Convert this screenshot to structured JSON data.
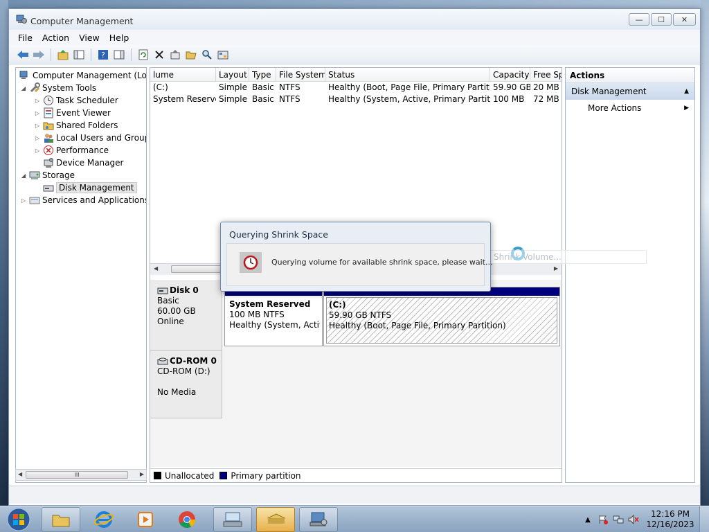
{
  "window": {
    "title": "Computer Management",
    "controls": {
      "minimize": "—",
      "maximize": "☐",
      "close": "✕"
    }
  },
  "menu": [
    "File",
    "Action",
    "View",
    "Help"
  ],
  "tree": {
    "root": "Computer Management (Local",
    "items": [
      {
        "label": "System Tools",
        "level": 1,
        "expander": "◢"
      },
      {
        "label": "Task Scheduler",
        "level": 2,
        "expander": "▷"
      },
      {
        "label": "Event Viewer",
        "level": 2,
        "expander": "▷"
      },
      {
        "label": "Shared Folders",
        "level": 2,
        "expander": "▷"
      },
      {
        "label": "Local Users and Groups",
        "level": 2,
        "expander": "▷"
      },
      {
        "label": "Performance",
        "level": 2,
        "expander": "▷"
      },
      {
        "label": "Device Manager",
        "level": 2,
        "expander": ""
      },
      {
        "label": "Storage",
        "level": 1,
        "expander": "◢"
      },
      {
        "label": "Disk Management",
        "level": 2,
        "expander": "",
        "selected": true
      },
      {
        "label": "Services and Applications",
        "level": 1,
        "expander": "▷"
      }
    ],
    "scroll_thumb": "III"
  },
  "volumes": {
    "columns": [
      "lume",
      "Layout",
      "Type",
      "File System",
      "Status",
      "Capacity",
      "Free Spa"
    ],
    "rows": [
      [
        "(C:)",
        "Simple",
        "Basic",
        "NTFS",
        "Healthy (Boot, Page File, Primary Partition)",
        "59.90 GB",
        "20 MB"
      ],
      [
        "System Reserved",
        "Simple",
        "Basic",
        "NTFS",
        "Healthy (System, Active, Primary Partition)",
        "100 MB",
        "72 MB"
      ]
    ]
  },
  "disks": {
    "disk0": {
      "name": "Disk 0",
      "type": "Basic",
      "size": "60.00 GB",
      "state": "Online",
      "partitions": [
        {
          "name": "System Reserved",
          "size": "100 MB NTFS",
          "status": "Healthy (System, Active,"
        },
        {
          "name": "(C:)",
          "size": "59.90 GB NTFS",
          "status": "Healthy (Boot, Page File, Primary Partition)"
        }
      ]
    },
    "cdrom0": {
      "name": "CD-ROM 0",
      "drive": "CD-ROM (D:)",
      "media": "No Media"
    }
  },
  "legend": [
    {
      "label": "Unallocated",
      "color": "#000000"
    },
    {
      "label": "Primary partition",
      "color": "#00007e"
    }
  ],
  "actions": {
    "title": "Actions",
    "section": "Disk Management",
    "items": [
      "More Actions"
    ]
  },
  "dialog": {
    "title": "Querying Shrink Space",
    "message": "Querying volume for available shrink space, please wait..."
  },
  "ghost_menu": "Shrink Volume...",
  "taskbar": {
    "apps": [
      "file-explorer",
      "internet-explorer",
      "media-player",
      "chrome",
      "on-screen-keyboard",
      "disk-drive",
      "computer-management"
    ],
    "clock_time": "12:16 PM",
    "clock_date": "12/16/2023"
  },
  "colors": {
    "primary_partition": "#00007e",
    "selection_bg": "#c9d8ea",
    "taskbar_active": "#e7b04c"
  }
}
